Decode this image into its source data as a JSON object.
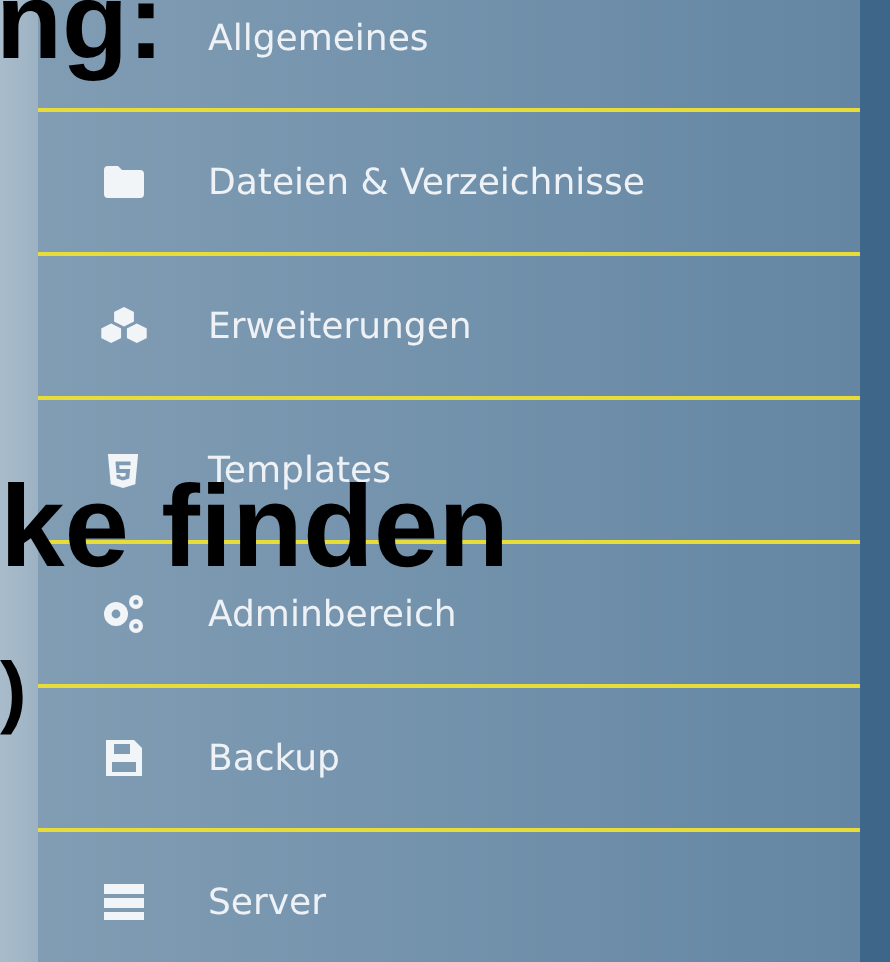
{
  "menu": {
    "items": [
      {
        "label": "Allgemeines"
      },
      {
        "label": "Dateien & Verzeichnisse"
      },
      {
        "label": "Erweiterungen"
      },
      {
        "label": "Templates"
      },
      {
        "label": "Adminbereich"
      },
      {
        "label": "Backup"
      },
      {
        "label": "Server"
      }
    ]
  },
  "overlay_texts": [
    "ng:",
    "ke finden",
    ")"
  ]
}
